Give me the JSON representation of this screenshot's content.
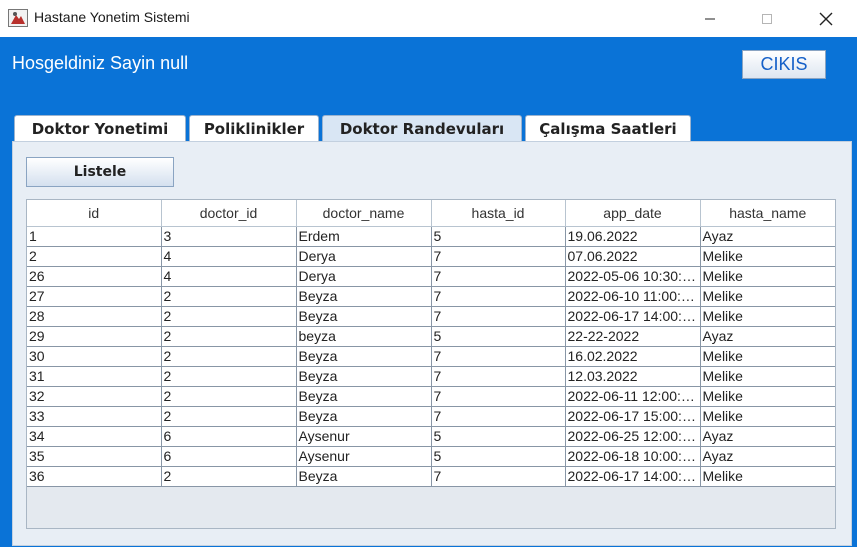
{
  "window": {
    "title": "Hastane Yonetim Sistemi",
    "controls": [
      "minimize",
      "maximize",
      "close"
    ]
  },
  "header": {
    "welcome": "Hosgeldiniz Sayin null",
    "exit_label": "CIKIS"
  },
  "tabs": [
    {
      "label": "Doktor Yonetimi",
      "active": false
    },
    {
      "label": "Poliklinikler",
      "active": false
    },
    {
      "label": "Doktor Randevuları",
      "active": true
    },
    {
      "label": "Çalışma Saatleri",
      "active": false
    }
  ],
  "list_button_label": "Listele",
  "table": {
    "columns": [
      "id",
      "doctor_id",
      "doctor_name",
      "hasta_id",
      "app_date",
      "hasta_name"
    ],
    "rows": [
      [
        "1",
        "3",
        "Erdem",
        "5",
        "19.06.2022",
        "Ayaz"
      ],
      [
        "2",
        "4",
        "Derya",
        "7",
        "07.06.2022",
        "Melike"
      ],
      [
        "26",
        "4",
        "Derya",
        "7",
        "2022-05-06 10:30:0...",
        "Melike"
      ],
      [
        "27",
        "2",
        "Beyza",
        "7",
        "2022-06-10 11:00:0...",
        "Melike"
      ],
      [
        "28",
        "2",
        "Beyza",
        "7",
        "2022-06-17 14:00:0...",
        "Melike"
      ],
      [
        "29",
        "2",
        "beyza",
        "5",
        "22-22-2022",
        "Ayaz"
      ],
      [
        "30",
        "2",
        "Beyza",
        "7",
        "16.02.2022",
        "Melike"
      ],
      [
        "31",
        "2",
        "Beyza",
        "7",
        "12.03.2022",
        "Melike"
      ],
      [
        "32",
        "2",
        "Beyza",
        "7",
        "2022-06-11 12:00:0...",
        "Melike"
      ],
      [
        "33",
        "2",
        "Beyza",
        "7",
        "2022-06-17 15:00:0...",
        "Melike"
      ],
      [
        "34",
        "6",
        "Aysenur",
        "5",
        "2022-06-25 12:00:0...",
        "Ayaz"
      ],
      [
        "35",
        "6",
        "Aysenur",
        "5",
        "2022-06-18 10:00:0...",
        "Ayaz"
      ],
      [
        "36",
        "2",
        "Beyza",
        "7",
        "2022-06-17 14:00:0...",
        "Melike"
      ]
    ]
  },
  "colors": {
    "frame_blue": "#0a73d7",
    "panel_bg": "#e8eef5",
    "active_tab": "#d9e6f4",
    "exit_text": "#1560c8"
  }
}
